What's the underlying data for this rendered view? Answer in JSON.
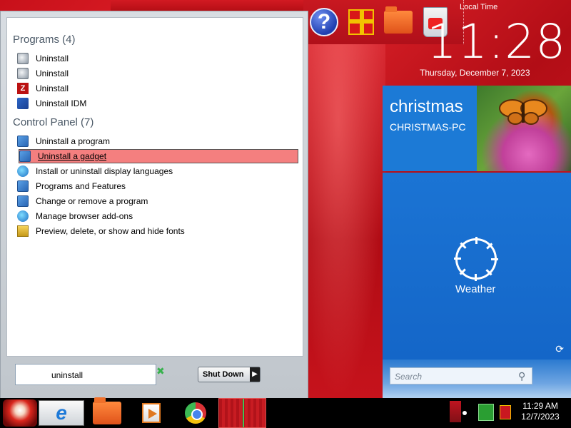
{
  "desktop": {
    "clock_label": "Local Time",
    "clock_time": "11:28",
    "clock_date": "Thursday, December 7, 2023",
    "top_icons": [
      "help-icon",
      "gift-icon",
      "folder-icon",
      "recycle-bin-icon"
    ]
  },
  "tiles": {
    "user_name": "christmas",
    "pc_name": "CHRISTMAS-PC",
    "weather_label": "Weather",
    "search_placeholder": "Search"
  },
  "start_menu": {
    "programs_header": "Programs (4)",
    "programs": [
      {
        "label": "Uninstall",
        "icon": "disc-icon"
      },
      {
        "label": "Uninstall",
        "icon": "disc-icon"
      },
      {
        "label": "Uninstall",
        "icon": "z-app-icon"
      },
      {
        "label": "Uninstall IDM",
        "icon": "idm-icon"
      }
    ],
    "control_panel_header": "Control Panel (7)",
    "control_panel": [
      {
        "label": "Uninstall a program",
        "icon": "control-panel-icon"
      },
      {
        "label": "Uninstall a gadget",
        "icon": "gadget-icon",
        "highlighted": true
      },
      {
        "label": "Install or uninstall display languages",
        "icon": "globe-icon"
      },
      {
        "label": "Programs and Features",
        "icon": "control-panel-icon"
      },
      {
        "label": "Change or remove a program",
        "icon": "control-panel-icon"
      },
      {
        "label": "Manage browser add-ons",
        "icon": "globe-icon"
      },
      {
        "label": "Preview, delete, or show and hide fonts",
        "icon": "font-icon"
      }
    ],
    "search_value": "uninstall",
    "shutdown_label": "Shut Down"
  },
  "taskbar": {
    "pinned": [
      "start-orb",
      "internet-explorer-icon",
      "explorer-folder-icon",
      "media-player-icon",
      "chrome-icon"
    ],
    "tray_time": "11:29 AM",
    "tray_date": "12/7/2023"
  }
}
